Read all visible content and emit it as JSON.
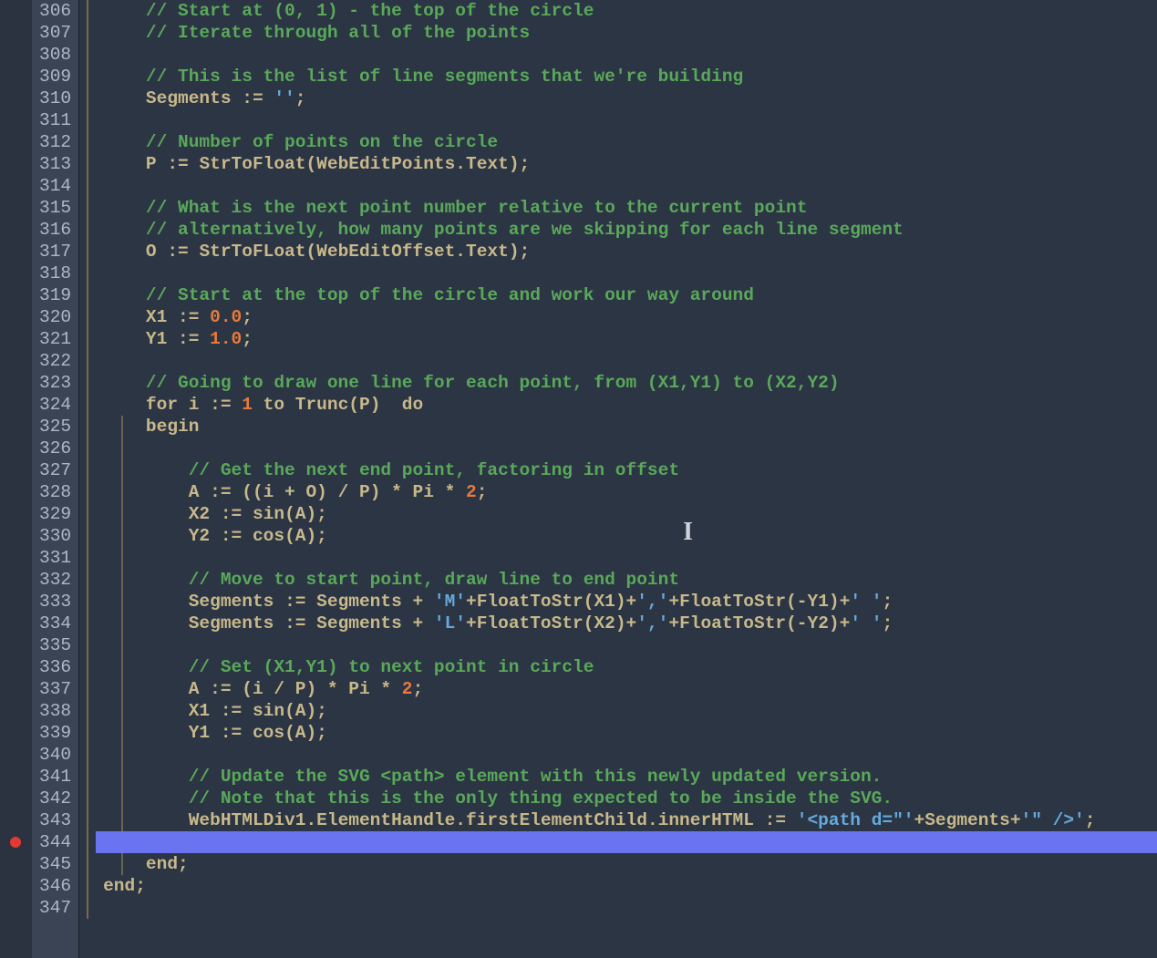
{
  "editor": {
    "first_line": 306,
    "last_line": 347,
    "highlighted_line": 344,
    "breakpoint_line": 344,
    "caret_ibeam_line": 330
  },
  "code": {
    "306": [
      [
        "comment",
        "// Start at (0, 1) - the top of the circle"
      ]
    ],
    "307": [
      [
        "comment",
        "// Iterate through all of the points"
      ]
    ],
    "308": [],
    "309": [
      [
        "comment",
        "// This is the list of line segments that we're building"
      ]
    ],
    "310": [
      [
        "id",
        "Segments "
      ],
      [
        "punct",
        ":= "
      ],
      [
        "str",
        "''"
      ],
      [
        "punct",
        ";"
      ]
    ],
    "311": [],
    "312": [
      [
        "comment",
        "// Number of points on the circle"
      ]
    ],
    "313": [
      [
        "id",
        "P "
      ],
      [
        "punct",
        ":= "
      ],
      [
        "func",
        "StrToFloat"
      ],
      [
        "punct",
        "("
      ],
      [
        "id",
        "WebEditPoints"
      ],
      [
        "punct",
        "."
      ],
      [
        "id",
        "Text"
      ],
      [
        "punct",
        ");"
      ]
    ],
    "314": [],
    "315": [
      [
        "comment",
        "// What is the next point number relative to the current point"
      ]
    ],
    "316": [
      [
        "comment",
        "// alternatively, how many points are we skipping for each line segment"
      ]
    ],
    "317": [
      [
        "id",
        "O "
      ],
      [
        "punct",
        ":= "
      ],
      [
        "func",
        "StrToFLoat"
      ],
      [
        "punct",
        "("
      ],
      [
        "id",
        "WebEditOffset"
      ],
      [
        "punct",
        "."
      ],
      [
        "id",
        "Text"
      ],
      [
        "punct",
        ");"
      ]
    ],
    "318": [],
    "319": [
      [
        "comment",
        "// Start at the top of the circle and work our way around"
      ]
    ],
    "320": [
      [
        "id",
        "X1 "
      ],
      [
        "punct",
        ":= "
      ],
      [
        "num",
        "0.0"
      ],
      [
        "punct",
        ";"
      ]
    ],
    "321": [
      [
        "id",
        "Y1 "
      ],
      [
        "punct",
        ":= "
      ],
      [
        "num",
        "1.0"
      ],
      [
        "punct",
        ";"
      ]
    ],
    "322": [],
    "323": [
      [
        "comment",
        "// Going to draw one line for each point, from (X1,Y1) to (X2,Y2)"
      ]
    ],
    "324": [
      [
        "kw",
        "for "
      ],
      [
        "id",
        "i "
      ],
      [
        "punct",
        ":= "
      ],
      [
        "num",
        "1"
      ],
      [
        "kw",
        " to "
      ],
      [
        "func",
        "Trunc"
      ],
      [
        "punct",
        "("
      ],
      [
        "id",
        "P"
      ],
      [
        "punct",
        ")  "
      ],
      [
        "kw",
        "do"
      ]
    ],
    "325": [
      [
        "kw",
        "begin"
      ]
    ],
    "326": [],
    "327": [
      [
        "comment",
        "// Get the next end point, factoring in offset"
      ]
    ],
    "328": [
      [
        "id",
        "A "
      ],
      [
        "punct",
        ":= (("
      ],
      [
        "id",
        "i"
      ],
      [
        "punct",
        " + "
      ],
      [
        "id",
        "O"
      ],
      [
        "punct",
        ") / "
      ],
      [
        "id",
        "P"
      ],
      [
        "punct",
        ") * "
      ],
      [
        "id",
        "Pi"
      ],
      [
        "punct",
        " * "
      ],
      [
        "num",
        "2"
      ],
      [
        "punct",
        ";"
      ]
    ],
    "329": [
      [
        "id",
        "X2 "
      ],
      [
        "punct",
        ":= "
      ],
      [
        "func",
        "sin"
      ],
      [
        "punct",
        "("
      ],
      [
        "id",
        "A"
      ],
      [
        "punct",
        ");"
      ]
    ],
    "330": [
      [
        "id",
        "Y2 "
      ],
      [
        "punct",
        ":= "
      ],
      [
        "func",
        "cos"
      ],
      [
        "punct",
        "("
      ],
      [
        "id",
        "A"
      ],
      [
        "punct",
        ");"
      ]
    ],
    "331": [],
    "332": [
      [
        "comment",
        "// Move to start point, draw line to end point"
      ]
    ],
    "333": [
      [
        "id",
        "Segments "
      ],
      [
        "punct",
        ":= "
      ],
      [
        "id",
        "Segments"
      ],
      [
        "punct",
        " + "
      ],
      [
        "str",
        "'M'"
      ],
      [
        "punct",
        "+"
      ],
      [
        "func",
        "FloatToStr"
      ],
      [
        "punct",
        "("
      ],
      [
        "id",
        "X1"
      ],
      [
        "punct",
        ")+"
      ],
      [
        "str",
        "','"
      ],
      [
        "punct",
        "+"
      ],
      [
        "func",
        "FloatToStr"
      ],
      [
        "punct",
        "(-"
      ],
      [
        "id",
        "Y1"
      ],
      [
        "punct",
        ")+"
      ],
      [
        "str",
        "' '"
      ],
      [
        "punct",
        ";"
      ]
    ],
    "334": [
      [
        "id",
        "Segments "
      ],
      [
        "punct",
        ":= "
      ],
      [
        "id",
        "Segments"
      ],
      [
        "punct",
        " + "
      ],
      [
        "str",
        "'L'"
      ],
      [
        "punct",
        "+"
      ],
      [
        "func",
        "FloatToStr"
      ],
      [
        "punct",
        "("
      ],
      [
        "id",
        "X2"
      ],
      [
        "punct",
        ")+"
      ],
      [
        "str",
        "','"
      ],
      [
        "punct",
        "+"
      ],
      [
        "func",
        "FloatToStr"
      ],
      [
        "punct",
        "(-"
      ],
      [
        "id",
        "Y2"
      ],
      [
        "punct",
        ")+"
      ],
      [
        "str",
        "' '"
      ],
      [
        "punct",
        ";"
      ]
    ],
    "335": [],
    "336": [
      [
        "comment",
        "// Set (X1,Y1) to next point in circle"
      ]
    ],
    "337": [
      [
        "id",
        "A "
      ],
      [
        "punct",
        ":= ("
      ],
      [
        "id",
        "i"
      ],
      [
        "punct",
        " / "
      ],
      [
        "id",
        "P"
      ],
      [
        "punct",
        ") * "
      ],
      [
        "id",
        "Pi"
      ],
      [
        "punct",
        " * "
      ],
      [
        "num",
        "2"
      ],
      [
        "punct",
        ";"
      ]
    ],
    "338": [
      [
        "id",
        "X1 "
      ],
      [
        "punct",
        ":= "
      ],
      [
        "func",
        "sin"
      ],
      [
        "punct",
        "("
      ],
      [
        "id",
        "A"
      ],
      [
        "punct",
        ");"
      ]
    ],
    "339": [
      [
        "id",
        "Y1 "
      ],
      [
        "punct",
        ":= "
      ],
      [
        "func",
        "cos"
      ],
      [
        "punct",
        "("
      ],
      [
        "id",
        "A"
      ],
      [
        "punct",
        ");"
      ]
    ],
    "340": [],
    "341": [
      [
        "comment",
        "// Update the SVG <path> element with this newly updated version."
      ]
    ],
    "342": [
      [
        "comment",
        "// Note that this is the only thing expected to be inside the SVG."
      ]
    ],
    "343": [
      [
        "id",
        "WebHTMLDiv1"
      ],
      [
        "punct",
        "."
      ],
      [
        "id",
        "ElementHandle"
      ],
      [
        "punct",
        "."
      ],
      [
        "id",
        "firstElementChild"
      ],
      [
        "punct",
        "."
      ],
      [
        "id",
        "innerHTML"
      ],
      [
        "punct",
        " := "
      ],
      [
        "str",
        "'<path d=\"'"
      ],
      [
        "punct",
        "+"
      ],
      [
        "id",
        "Segments"
      ],
      [
        "punct",
        "+"
      ],
      [
        "str",
        "'\" />'"
      ],
      [
        "punct",
        ";"
      ]
    ],
    "344": [],
    "345": [
      [
        "kw",
        "end"
      ],
      [
        "punct",
        ";"
      ]
    ],
    "346": [
      [
        "kw",
        "end"
      ],
      [
        "punct",
        ";"
      ]
    ],
    "347": []
  },
  "indents": {
    "306": 2,
    "307": 2,
    "308": 0,
    "309": 2,
    "310": 2,
    "311": 0,
    "312": 2,
    "313": 2,
    "314": 0,
    "315": 2,
    "316": 2,
    "317": 2,
    "318": 0,
    "319": 2,
    "320": 2,
    "321": 2,
    "322": 0,
    "323": 2,
    "324": 2,
    "325": 2,
    "326": 0,
    "327": 4,
    "328": 4,
    "329": 4,
    "330": 4,
    "331": 0,
    "332": 4,
    "333": 4,
    "334": 4,
    "335": 0,
    "336": 4,
    "337": 4,
    "338": 4,
    "339": 4,
    "340": 0,
    "341": 4,
    "342": 4,
    "343": 4,
    "344": 0,
    "345": 2,
    "346": 0,
    "347": 0
  }
}
